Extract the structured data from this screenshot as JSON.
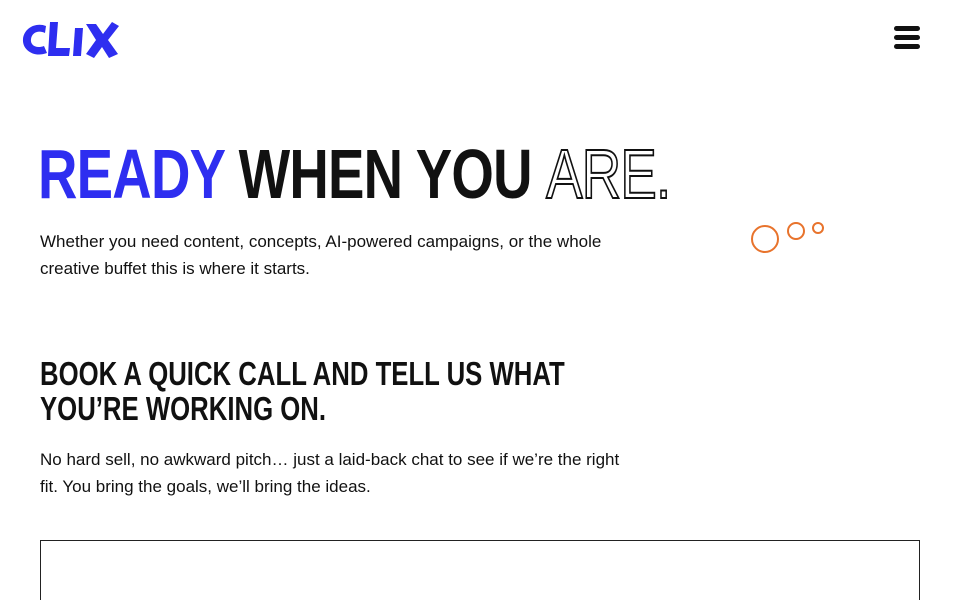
{
  "header": {
    "logo_text": "CLIX",
    "menu_icon": "hamburger-menu-icon"
  },
  "hero": {
    "title_word1": "READY",
    "title_word2": "WHEN YOU",
    "title_word3": "ARE.",
    "subtitle": "Whether you need content, concepts, AI-powered campaigns, or the whole creative buffet this is where it starts."
  },
  "cta": {
    "heading": "BOOK A QUICK CALL AND TELL US WHAT YOU’RE WORKING ON.",
    "text": "No hard sell, no awkward pitch… just a laid-back chat to see if we’re the right fit. You bring the goals, we’ll bring the ideas."
  },
  "colors": {
    "brand_blue": "#2e2ef0",
    "text": "#111111",
    "bubble_orange": "#e8732c"
  }
}
